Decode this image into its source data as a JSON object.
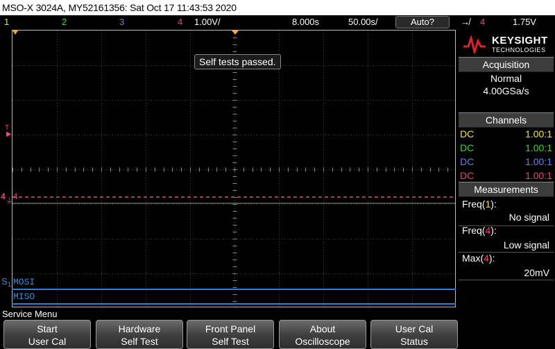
{
  "title_bar": {
    "text": "MSO-X 3024A, MY52161356: Sat Oct 17 11:43:53 2020"
  },
  "status_bar": {
    "ch1": "1",
    "ch2": "2",
    "ch3": "3",
    "ch4": "4",
    "volts_div": "1.00V/",
    "timebase": "8.000s",
    "time_div": "50.00s/",
    "run_mode": "Auto?",
    "trigger_channel": "4",
    "trigger_level": "1.75V",
    "ch_colors": {
      "1": "#f4e72c",
      "2": "#32e02c",
      "3": "#6a7bff",
      "4": "#f0427d"
    }
  },
  "screen": {
    "message": "Self tests passed.",
    "ch4_marker": "4",
    "trigger_marker": "T",
    "bus_marker": "S"
  },
  "bus": {
    "mosi": "MOSI",
    "miso": "MISO"
  },
  "brand": {
    "line1": "KEYSIGHT",
    "line2": "TECHNOLOGIES"
  },
  "acquisition": {
    "header": "Acquisition",
    "mode": "Normal",
    "rate": "4.00GSa/s"
  },
  "channels": {
    "header": "Channels",
    "rows": [
      {
        "coupling": "DC",
        "probe": "1.00:1"
      },
      {
        "coupling": "DC",
        "probe": "1.00:1"
      },
      {
        "coupling": "DC",
        "probe": "1.00:1"
      },
      {
        "coupling": "DC",
        "probe": "1.00:1"
      }
    ]
  },
  "measurements": {
    "header": "Measurements",
    "items": [
      {
        "name": "Freq",
        "channel": "1",
        "value": "No signal"
      },
      {
        "name": "Freq",
        "channel": "4",
        "value": "Low signal"
      },
      {
        "name": "Max",
        "channel": "4",
        "value": "20mV"
      }
    ]
  },
  "menu": {
    "title": "Service Menu",
    "softkeys": [
      {
        "line1": "Start",
        "line2": "User Cal"
      },
      {
        "line1": "Hardware",
        "line2": "Self Test"
      },
      {
        "line1": "Front Panel",
        "line2": "Self Test"
      },
      {
        "line1": "About",
        "line2": "Oscilloscope"
      },
      {
        "line1": "User Cal",
        "line2": "Status"
      }
    ]
  }
}
